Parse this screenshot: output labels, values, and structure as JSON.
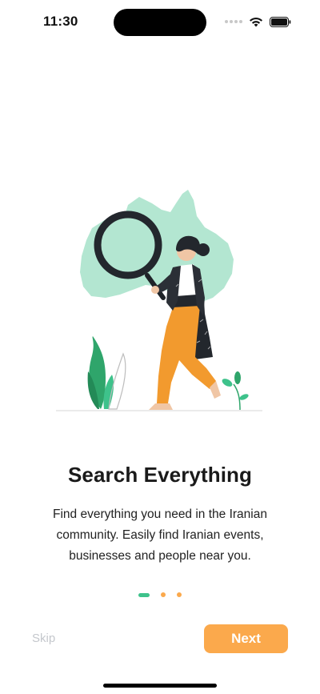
{
  "status_bar": {
    "time": "11:30",
    "icons": [
      "signal-dots-icon",
      "wifi-icon",
      "battery-icon"
    ]
  },
  "onboarding": {
    "title": "Search Everything",
    "description": "Find everything you need in the Iranian community. Easily find Iranian events, businesses and people near you.",
    "pager": {
      "count": 3,
      "active_index": 0
    },
    "skip_label": "Skip",
    "next_label": "Next"
  },
  "colors": {
    "accent_orange": "#FBA94C",
    "accent_green": "#3EC28B",
    "map_mint": "#B3E6D1",
    "skip_gray": "#C4C7CC",
    "pager_inactive": "#FBA94C"
  }
}
